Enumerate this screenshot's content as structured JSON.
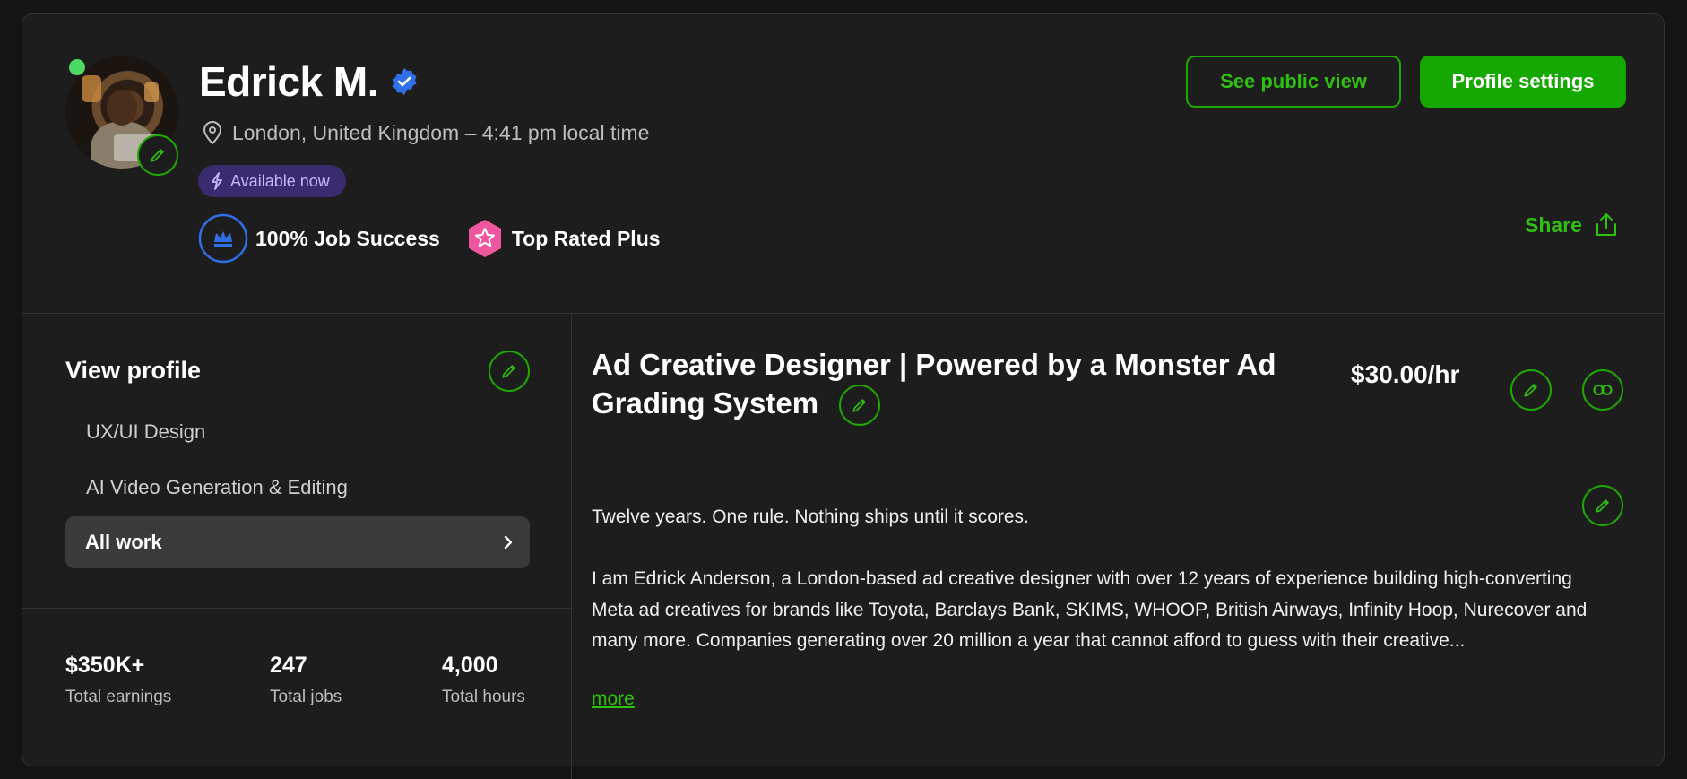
{
  "profile": {
    "name": "Edrick M.",
    "location": "London, United Kingdom – 4:41 pm local time",
    "availability": "Available now",
    "job_success": "100% Job Success",
    "top_rated": "Top Rated Plus"
  },
  "actions": {
    "public_view": "See public view",
    "settings": "Profile settings",
    "share": "Share"
  },
  "sidebar": {
    "heading": "View profile",
    "items": [
      {
        "label": "UX/UI Design"
      },
      {
        "label": "AI Video Generation & Editing"
      },
      {
        "label": "All work"
      }
    ]
  },
  "stats": [
    {
      "value": "$350K+",
      "label": "Total earnings"
    },
    {
      "value": "247",
      "label": "Total jobs"
    },
    {
      "value": "4,000",
      "label": "Total hours"
    }
  ],
  "main": {
    "title": "Ad Creative Designer | Powered by a Monster Ad Grading System",
    "rate": "$30.00/hr",
    "bio_line1": "Twelve years. One rule. Nothing ships until it scores.",
    "bio_line2": "I am Edrick Anderson, a London-based ad creative designer with over 12 years of experience building high-converting Meta ad creatives for brands like Toyota, Barclays Bank, SKIMS, WHOOP, British Airways, Infinity Hoop, Nurecover and many more. Companies generating over 20 million a year that cannot afford to guess with their creative...",
    "more": "more"
  },
  "colors": {
    "accent": "#14a800",
    "accent_text": "#2ec10f",
    "available_bg": "#3a2a6e",
    "verified": "#2f6fe8",
    "top_rated": "#f0569e"
  }
}
